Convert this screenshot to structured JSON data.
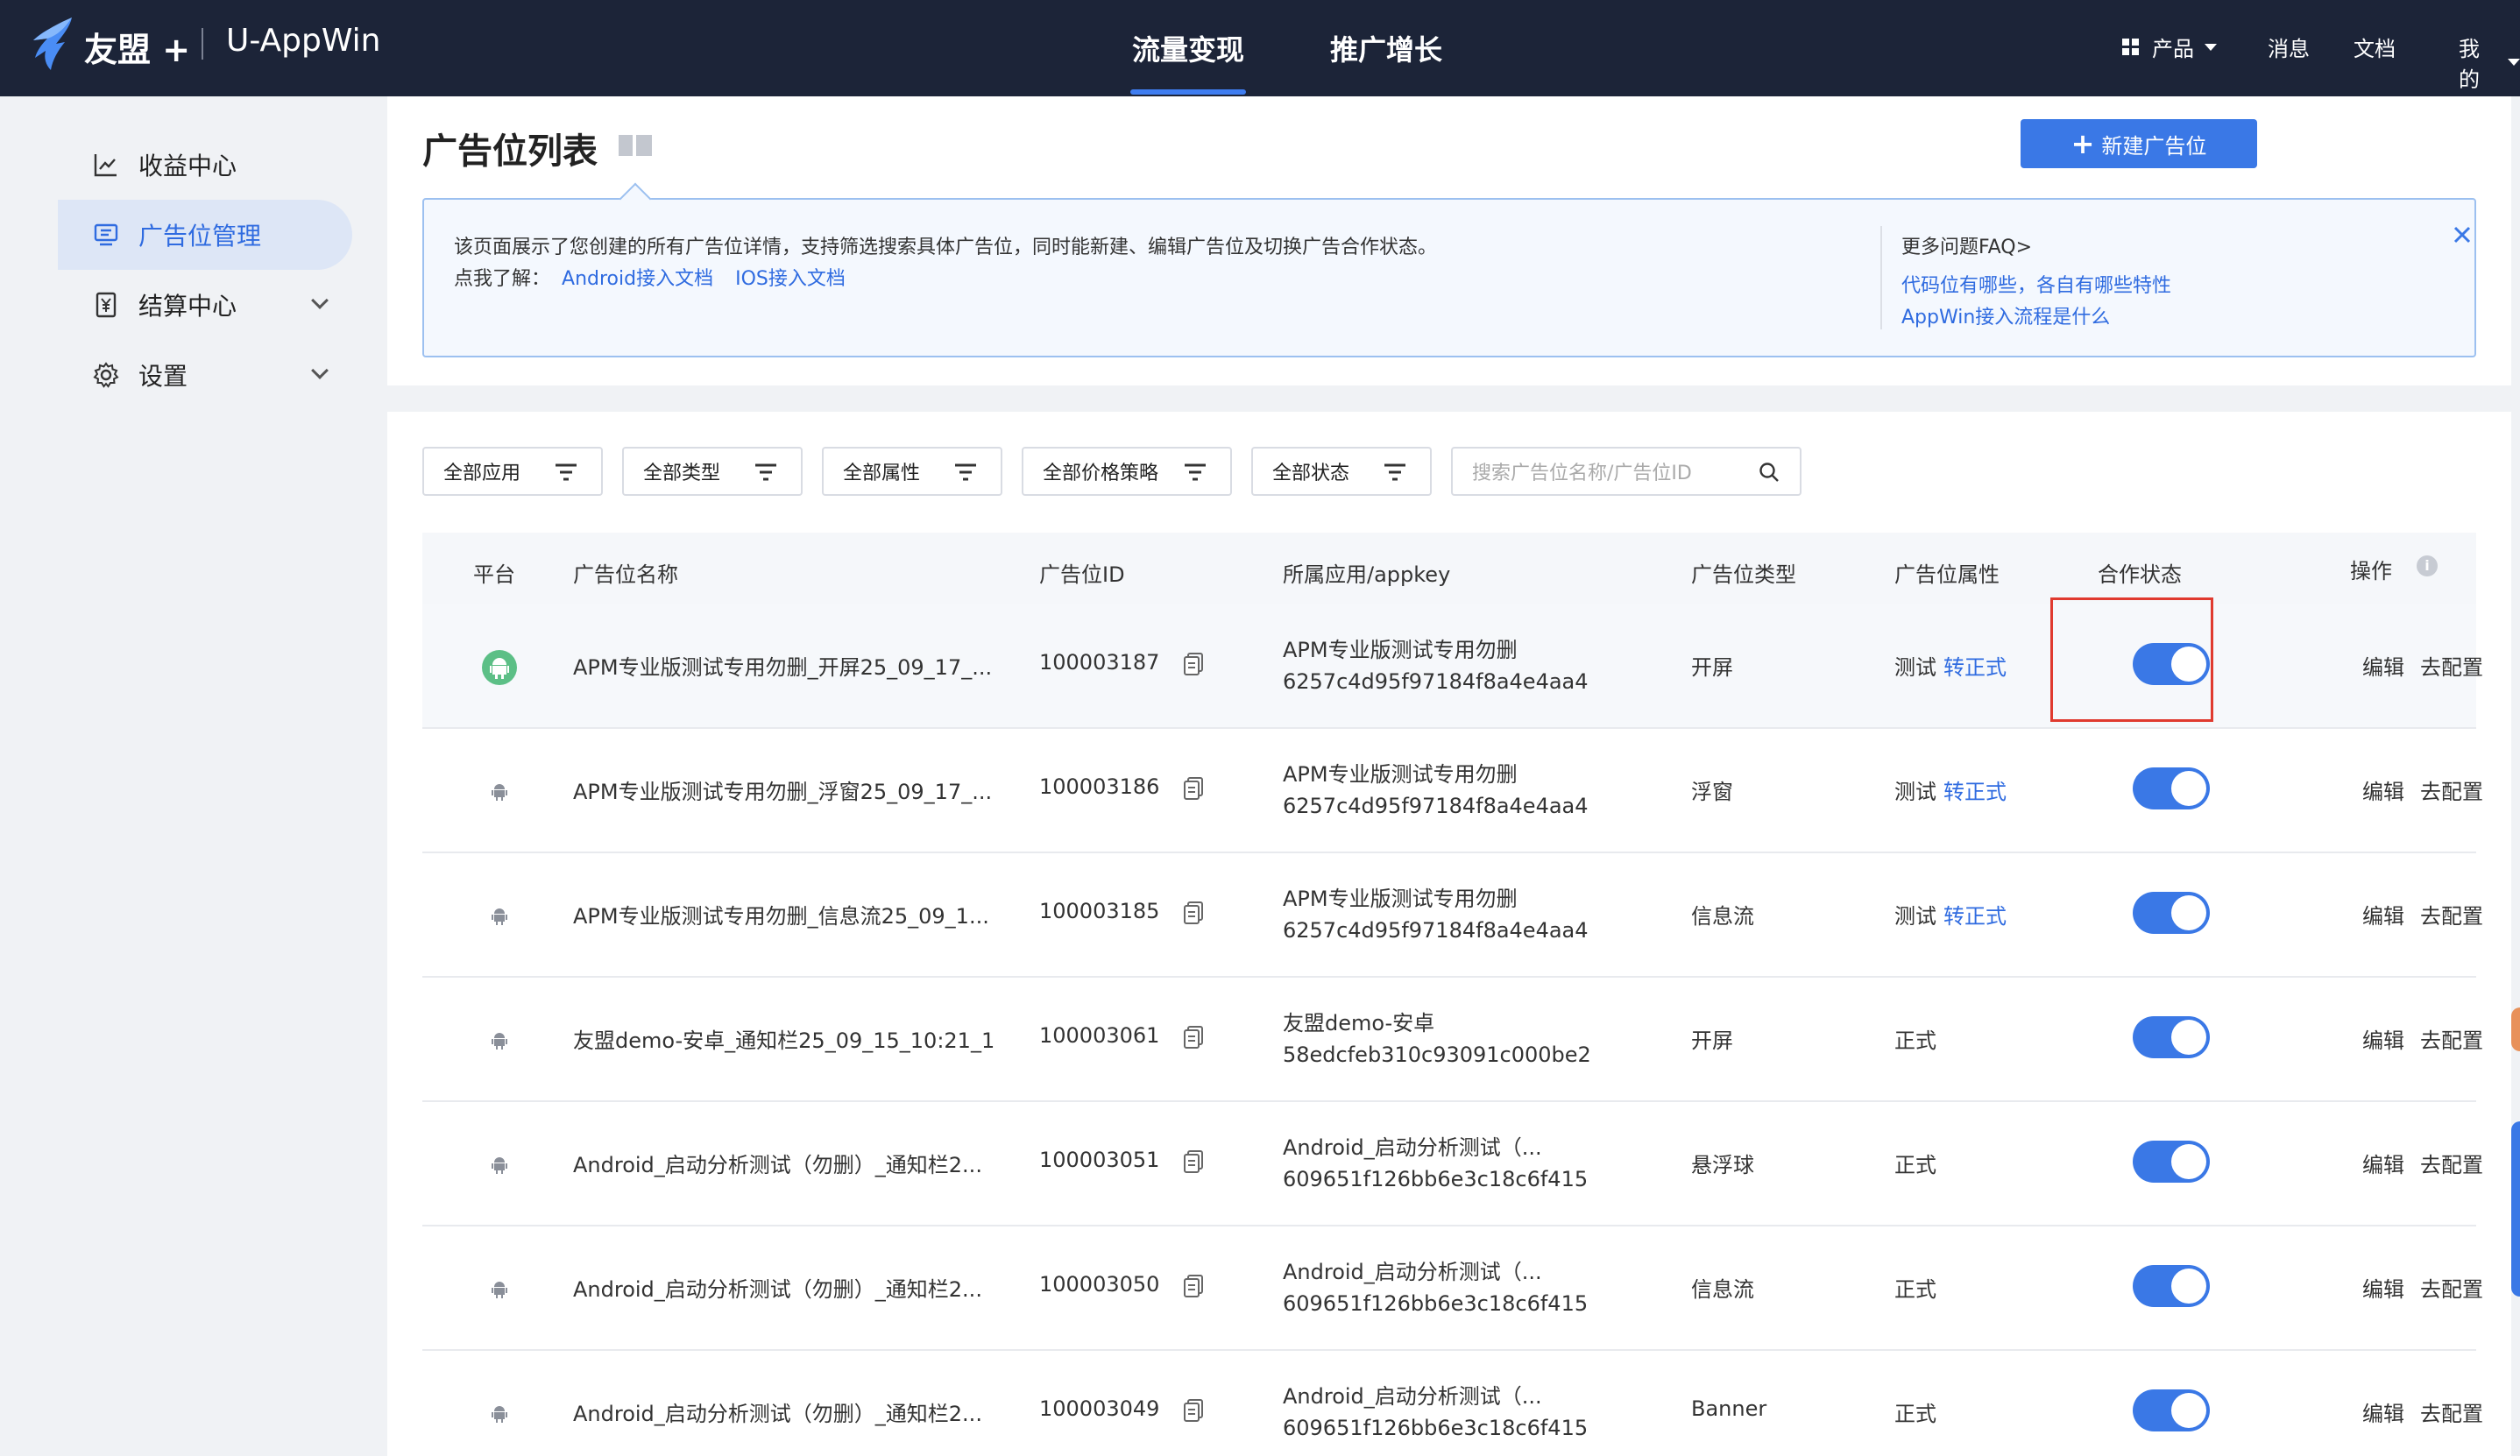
{
  "header": {
    "brand": "友盟 +",
    "product": "U-AppWin",
    "nav": [
      {
        "label": "流量变现",
        "active": true
      },
      {
        "label": "推广增长",
        "active": false
      }
    ],
    "right": {
      "products": "产品",
      "messages": "消息",
      "docs": "文档",
      "mine": "我的"
    },
    "icons": {
      "products": "grid-icon",
      "dropdown": "caret-down-icon"
    }
  },
  "sidebar": {
    "items": [
      {
        "label": "收益中心",
        "icon": "chart-icon",
        "active": false,
        "expandable": false
      },
      {
        "label": "广告位管理",
        "icon": "monitor-icon",
        "active": true,
        "expandable": false
      },
      {
        "label": "结算中心",
        "icon": "yen-icon",
        "active": false,
        "expandable": true
      },
      {
        "label": "设置",
        "icon": "gear-icon",
        "active": false,
        "expandable": true
      }
    ]
  },
  "page": {
    "title": "广告位列表",
    "new_button": "新建广告位",
    "notice": {
      "text": "该页面展示了您创建的所有广告位详情，支持筛选搜索具体广告位，同时能新建、编辑广告位及切换广告合作状态。",
      "learn_prefix": "点我了解：",
      "android_doc": "Android接入文档",
      "ios_doc": "IOS接入文档",
      "faq_title": "更多问题FAQ>",
      "faq_1": "代码位有哪些，各自有哪些特性",
      "faq_2": "AppWin接入流程是什么"
    }
  },
  "filters": {
    "app": "全部应用",
    "type": "全部类型",
    "attr": "全部属性",
    "price": "全部价格策略",
    "status": "全部状态",
    "search_placeholder": "搜索广告位名称/广告位ID"
  },
  "table": {
    "headers": {
      "platform": "平台",
      "name": "广告位名称",
      "id": "广告位ID",
      "app": "所属应用/appkey",
      "type": "广告位类型",
      "attr": "广告位属性",
      "status": "合作状态",
      "ops": "操作"
    },
    "ops": {
      "edit": "编辑",
      "config": "去配置"
    },
    "rows": [
      {
        "platform": "android-icon",
        "name": "APM专业版测试专用勿删_开屏25_09_17_...",
        "id": "100003187",
        "app": "APM专业版测试专用勿删",
        "appkey": "6257c4d95f97184f8a4e4aa4",
        "type": "开屏",
        "attr": "测试",
        "attr_link": "转正式",
        "active": true
      },
      {
        "platform": "android-icon",
        "name": "APM专业版测试专用勿删_浮窗25_09_17_...",
        "id": "100003186",
        "app": "APM专业版测试专用勿删",
        "appkey": "6257c4d95f97184f8a4e4aa4",
        "type": "浮窗",
        "attr": "测试",
        "attr_link": "转正式",
        "active": true
      },
      {
        "platform": "android-icon",
        "name": "APM专业版测试专用勿删_信息流25_09_1...",
        "id": "100003185",
        "app": "APM专业版测试专用勿删",
        "appkey": "6257c4d95f97184f8a4e4aa4",
        "type": "信息流",
        "attr": "测试",
        "attr_link": "转正式",
        "active": true
      },
      {
        "platform": "android-icon",
        "name": "友盟demo-安卓_通知栏25_09_15_10:21_1",
        "id": "100003061",
        "app": "友盟demo-安卓",
        "appkey": "58edcfeb310c93091c000be2",
        "type": "开屏",
        "attr": "正式",
        "attr_link": "",
        "active": true
      },
      {
        "platform": "android-icon",
        "name": "Android_启动分析测试（勿删）_通知栏2...",
        "id": "100003051",
        "app": "Android_启动分析测试（...",
        "appkey": "609651f126bb6e3c18c6f415",
        "type": "悬浮球",
        "attr": "正式",
        "attr_link": "",
        "active": true
      },
      {
        "platform": "android-icon",
        "name": "Android_启动分析测试（勿删）_通知栏2...",
        "id": "100003050",
        "app": "Android_启动分析测试（...",
        "appkey": "609651f126bb6e3c18c6f415",
        "type": "信息流",
        "attr": "正式",
        "attr_link": "",
        "active": true
      },
      {
        "platform": "android-icon",
        "name": "Android_启动分析测试（勿删）_通知栏2...",
        "id": "100003049",
        "app": "Android_启动分析测试（...",
        "appkey": "609651f126bb6e3c18c6f415",
        "type": "Banner",
        "attr": "正式",
        "attr_link": "",
        "active": true
      }
    ]
  },
  "colors": {
    "topbar": "#1c2438",
    "accent": "#3a78e6",
    "highlight": "#e03a2f",
    "android": "#5cbf86"
  }
}
